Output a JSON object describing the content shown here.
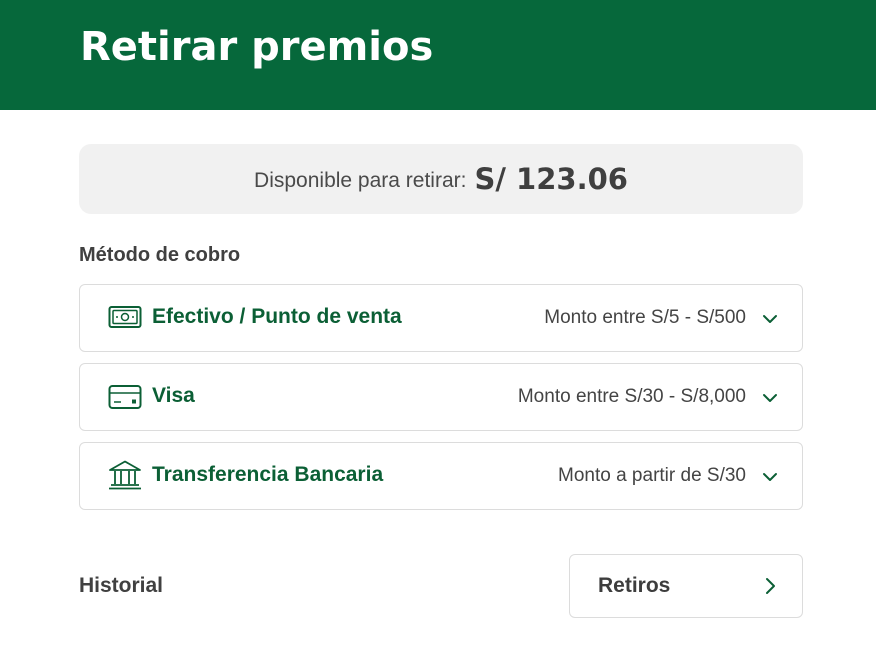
{
  "header": {
    "title": "Retirar premios"
  },
  "balance": {
    "label": "Disponible para retirar:",
    "amount": "S/ 123.06"
  },
  "methods_section": {
    "title": "Método de cobro",
    "items": [
      {
        "icon": "cash-icon",
        "name": "Efectivo / Punto de venta",
        "range": "Monto entre S/5 - S/500"
      },
      {
        "icon": "card-icon",
        "name": "Visa",
        "range": "Monto entre S/30 - S/8,000"
      },
      {
        "icon": "bank-icon",
        "name": "Transferencia Bancaria",
        "range": "Monto a partir de S/30"
      }
    ]
  },
  "history": {
    "title": "Historial",
    "button_label": "Retiros"
  },
  "colors": {
    "brand_green": "#06683b",
    "accent_green": "#0b5f35"
  }
}
